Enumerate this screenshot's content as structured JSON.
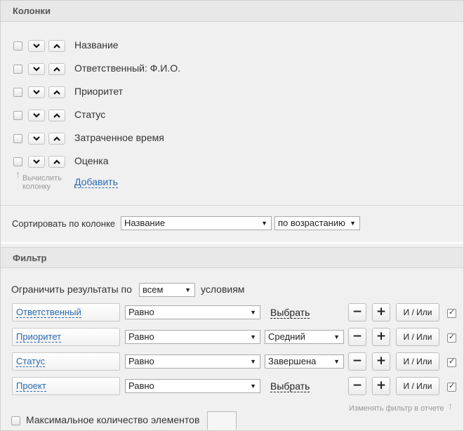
{
  "columns_section": {
    "title": "Колонки",
    "items": [
      {
        "label": "Название"
      },
      {
        "label": "Ответственный: Ф.И.О."
      },
      {
        "label": "Приоритет"
      },
      {
        "label": "Статус"
      },
      {
        "label": "Затраченное время"
      },
      {
        "label": "Оценка"
      }
    ],
    "calc_hint_line1": "Вычислить",
    "calc_hint_line2": "колонку",
    "add_link": "Добавить",
    "sort_label": "Сортировать по колонке",
    "sort_column": "Название",
    "sort_order": "по возрастанию"
  },
  "filter_section": {
    "title": "Фильтр",
    "limit_prefix": "Ограничить результаты по",
    "limit_value": "всем",
    "limit_suffix": "условиям",
    "rows": [
      {
        "field": "Ответственный",
        "operator": "Равно",
        "value_type": "link",
        "value": "Выбрать",
        "andor": "И / Или",
        "checked": true
      },
      {
        "field": "Приоритет",
        "operator": "Равно",
        "value_type": "select",
        "value": "Средний",
        "andor": "И / Или",
        "checked": true
      },
      {
        "field": "Статус",
        "operator": "Равно",
        "value_type": "select",
        "value": "Завершена",
        "andor": "И / Или",
        "checked": true
      },
      {
        "field": "Проект",
        "operator": "Равно",
        "value_type": "link",
        "value": "Выбрать",
        "andor": "И / Или",
        "checked": true
      }
    ],
    "minus_label": "−",
    "plus_label": "+",
    "change_hint": "Изменять фильтр в отчете",
    "max_label": "Максимальное количество элементов",
    "max_value": ""
  }
}
